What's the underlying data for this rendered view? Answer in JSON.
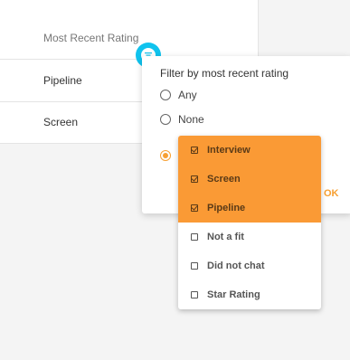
{
  "table": {
    "rows": [
      {
        "label": "Most Recent Rating"
      },
      {
        "label": "Pipeline"
      },
      {
        "label": "Screen"
      }
    ]
  },
  "filter_panel": {
    "title": "Filter by most recent rating",
    "radio_options": [
      {
        "label": "Any",
        "selected": false
      },
      {
        "label": "None",
        "selected": false
      },
      {
        "label": "",
        "selected": true
      }
    ],
    "ok_label": "OK"
  },
  "rating_options": [
    {
      "label": "Interview",
      "checked": true
    },
    {
      "label": "Screen",
      "checked": true
    },
    {
      "label": "Pipeline",
      "checked": true
    },
    {
      "label": "Not a fit",
      "checked": false
    },
    {
      "label": "Did not chat",
      "checked": false
    },
    {
      "label": "Star Rating",
      "checked": false
    }
  ],
  "colors": {
    "accent": "#fa9a35",
    "filter_button": "#10c3ee"
  }
}
